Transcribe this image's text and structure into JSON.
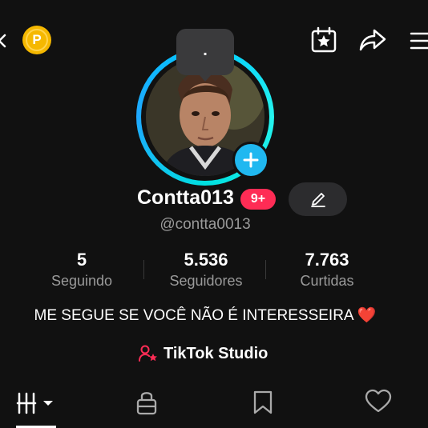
{
  "header": {
    "coin_letter": "P",
    "icons": [
      "back-icon",
      "coin-icon",
      "calendar-star-icon",
      "share-icon",
      "menu-icon"
    ]
  },
  "tooltip": {
    "text": "."
  },
  "profile": {
    "display_name": "Contta013",
    "badge": "9+",
    "username": "@contta0013",
    "bio": "ME SEGUE SE VOCÊ NÃO É INTERESSEIRA ❤️"
  },
  "stats": [
    {
      "value": "5",
      "label": "Seguindo"
    },
    {
      "value": "5.536",
      "label": "Seguidores"
    },
    {
      "value": "7.763",
      "label": "Curtidas"
    }
  ],
  "studio": {
    "label": "TikTok Studio"
  },
  "tabs": [
    "videos-grid-tab",
    "private-tab",
    "saved-tab",
    "liked-tab"
  ],
  "colors": {
    "background": "#111111",
    "ring_start": "#25F4EE",
    "ring_end": "#00C8FF",
    "badge": "#FE2C55",
    "coin": "#F5B800",
    "plus": "#20B8F0"
  }
}
